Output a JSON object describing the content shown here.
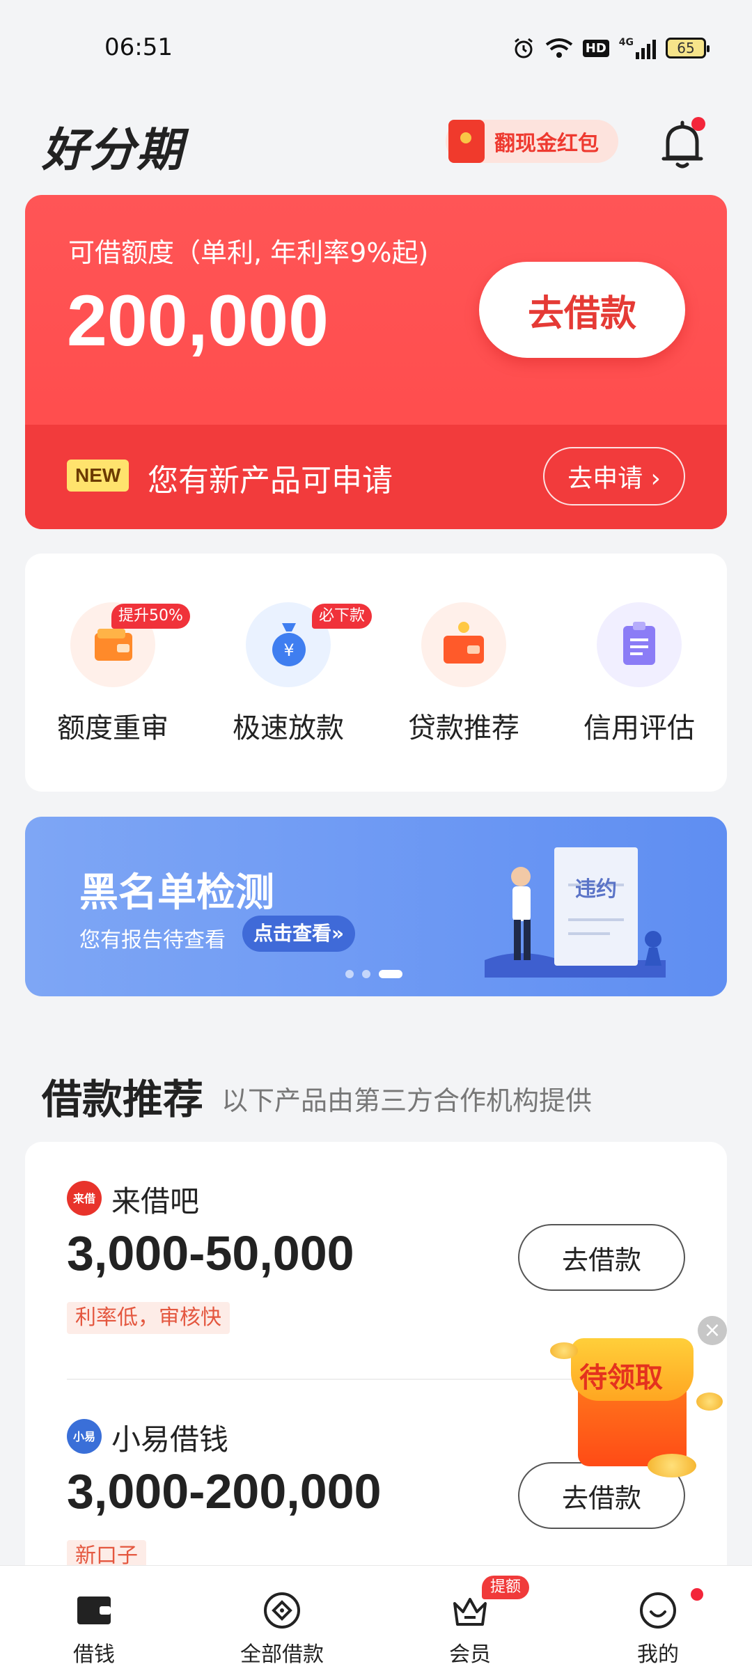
{
  "status_bar": {
    "time": "06:51",
    "network": "4G",
    "hd": "HD",
    "battery": "65"
  },
  "header": {
    "logo": "好分期",
    "red_packet_label": "翻现金红包"
  },
  "credit": {
    "caption": "可借额度（单利, 年利率9%起)",
    "amount": "200,000",
    "borrow_button": "去借款",
    "new_badge": "NEW",
    "new_product_text": "您有新产品可申请",
    "apply_button": "去申请 ›"
  },
  "shortcuts": [
    {
      "label": "额度重审",
      "tag": "提升50%"
    },
    {
      "label": "极速放款",
      "tag": "必下款"
    },
    {
      "label": "贷款推荐",
      "tag": ""
    },
    {
      "label": "信用评估",
      "tag": ""
    }
  ],
  "banner": {
    "title": "黑名单检测",
    "subtitle": "您有报告待查看",
    "button": "点击查看»",
    "doc_stamp": "违约"
  },
  "section": {
    "title": "借款推荐",
    "subtitle": "以下产品由第三方合作机构提供"
  },
  "products": [
    {
      "name": "来借吧",
      "range": "3,000-50,000",
      "tag": "利率低，审核快",
      "button": "去借款",
      "logo_text": "来借"
    },
    {
      "name": "小易借钱",
      "range": "3,000-200,000",
      "tag": "新口子",
      "button": "去借款",
      "logo_text": "小易"
    }
  ],
  "floating_packet": {
    "label": "待领取"
  },
  "tabbar": [
    {
      "label": "借钱",
      "badge": ""
    },
    {
      "label": "全部借款",
      "badge": ""
    },
    {
      "label": "会员",
      "badge": "提额"
    },
    {
      "label": "我的",
      "badge": ""
    }
  ],
  "colors": {
    "accent_red": "#ff4a4a",
    "banner_blue": "#6b95f3",
    "badge_yellow": "#ffe36d"
  }
}
